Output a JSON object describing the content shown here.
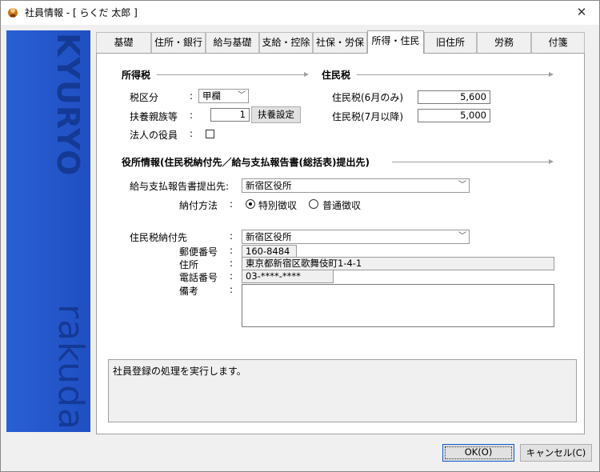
{
  "window": {
    "title": "社員情報 - [ らくだ 太郎 ]",
    "close_glyph": "✕"
  },
  "sidebar": {
    "logo_top": "KYURYO",
    "logo_bottom": "rakuda"
  },
  "tabs": [
    {
      "label": "基礎"
    },
    {
      "label": "住所・銀行"
    },
    {
      "label": "給与基礎"
    },
    {
      "label": "支給・控除"
    },
    {
      "label": "社保・労保"
    },
    {
      "label": "所得・住民"
    },
    {
      "label": "旧住所"
    },
    {
      "label": "労務"
    },
    {
      "label": "付箋"
    }
  ],
  "income_tax": {
    "heading": "所得税",
    "tax_class_label": "税区分",
    "tax_class_value": "甲欄",
    "dependents_label": "扶養親族等",
    "dependents_value": "1",
    "dependents_button": "扶養設定",
    "officer_label": "法人の役員"
  },
  "resident_tax": {
    "heading": "住民税",
    "june_label": "住民税(6月のみ)",
    "june_value": "5,600",
    "july_label": "住民税(7月以降)",
    "july_value": "5,000"
  },
  "office": {
    "heading": "役所情報(住民税納付先／給与支払報告書(総括表)提出先)",
    "report_label": "給与支払報告書提出先:",
    "report_value": "新宿区役所",
    "payment_label": "納付方法",
    "payment_options": [
      "特別徴収",
      "普通徴収"
    ],
    "payee_label": "住民税納付先",
    "payee_value": "新宿区役所",
    "postal_label": "郵便番号",
    "postal_value": "160-8484",
    "address_label": "住所",
    "address_value": "東京都新宿区歌舞伎町1-4-1",
    "phone_label": "電話番号",
    "phone_value": "03-****-****",
    "notes_label": "備考",
    "notes_value": ""
  },
  "colon": ":",
  "message": "社員登録の処理を実行します。",
  "buttons": {
    "ok": "OK(O)",
    "cancel": "キャンセル(C)"
  },
  "colors": {
    "sidebar": "#1f54c8",
    "ok_border": "#0a59d1"
  }
}
